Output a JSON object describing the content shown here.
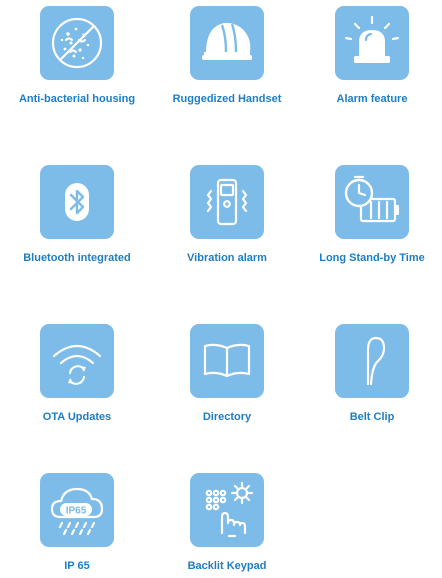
{
  "features": [
    {
      "label": "Anti-bacterial housing",
      "icon": "anti-bacterial-icon"
    },
    {
      "label": "Ruggedized Handset",
      "icon": "hard-hat-icon"
    },
    {
      "label": "Alarm feature",
      "icon": "alarm-light-icon"
    },
    {
      "label": "Bluetooth integrated",
      "icon": "bluetooth-icon"
    },
    {
      "label": "Vibration alarm",
      "icon": "vibrating-phone-icon"
    },
    {
      "label": "Long Stand-by Time",
      "icon": "clock-battery-icon"
    },
    {
      "label": "OTA Updates",
      "icon": "wifi-sync-icon"
    },
    {
      "label": "Directory",
      "icon": "open-book-icon"
    },
    {
      "label": "Belt Clip",
      "icon": "belt-clip-icon"
    },
    {
      "label": "IP 65",
      "icon": "rain-cloud-icon",
      "icon_text": "IP65"
    },
    {
      "label": "Backlit Keypad",
      "icon": "backlit-keypad-icon"
    }
  ],
  "colors": {
    "tile": "#7dbbe8",
    "label": "#1f7dc3",
    "background": "#ffffff"
  }
}
